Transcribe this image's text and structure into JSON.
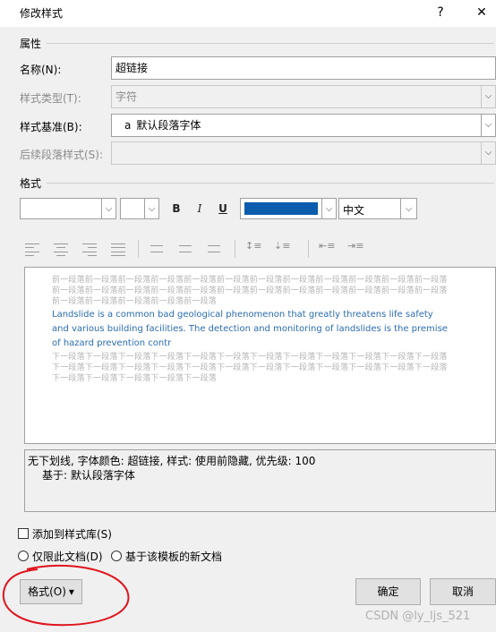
{
  "window": {
    "title": "修改样式",
    "help_icon": "?",
    "close_icon": "✕"
  },
  "properties": {
    "section_label": "属性",
    "name_label": "名称(N):",
    "name_value": "超链接",
    "style_type_label": "样式类型(T):",
    "style_type_value": "字符",
    "based_on_label": "样式基准(B):",
    "based_on_icon": "a",
    "based_on_value": "默认段落字体",
    "next_style_label": "后续段落样式(S):",
    "next_style_value": ""
  },
  "format": {
    "section_label": "格式",
    "font_value": "",
    "size_value": "",
    "bold_label": "B",
    "italic_label": "I",
    "underline_label": "U",
    "font_color": "#0b5cad",
    "language_value": "中文"
  },
  "preview": {
    "prev_paragraph": "前一段落前一段落前一段落前一段落前一段落前一段落前一段落前一段落前一段落前一段落前一段落前一段落前一段落前一段落前一段落前一段落前一段落前一段落前一段落前一段落前一段落前一段落前一段落前一段落前一段落前一段落前一段落前一段落前一段落",
    "sample_text": "Landslide is a common bad geological phenomenon that greatly threatens life safety and various building facilities. The detection and monitoring of landslides is the premise of hazard prevention contr",
    "next_paragraph": "下一段落下一段落下一段落下一段落下一段落下一段落下一段落下一段落下一段落下一段落下一段落下一段落下一段落下一段落下一段落下一段落下一段落下一段落下一段落下一段落下一段落下一段落下一段落下一段落下一段落下一段落下一段落下一段落下一段落"
  },
  "description": {
    "line1": "无下划线, 字体颜色: 超链接, 样式: 使用前隐藏, 优先级: 100",
    "line2": "基于: 默认段落字体"
  },
  "options": {
    "add_to_gallery": "添加到样式库(S)",
    "only_this_doc": "仅限此文档(D)",
    "new_docs_template": "基于该模板的新文档"
  },
  "buttons": {
    "format": "格式(O)",
    "format_arrow": "▾",
    "ok": "确定",
    "cancel": "取消"
  },
  "watermark": "CSDN @ly_ljs_521",
  "annotation_color": "#e0141e"
}
